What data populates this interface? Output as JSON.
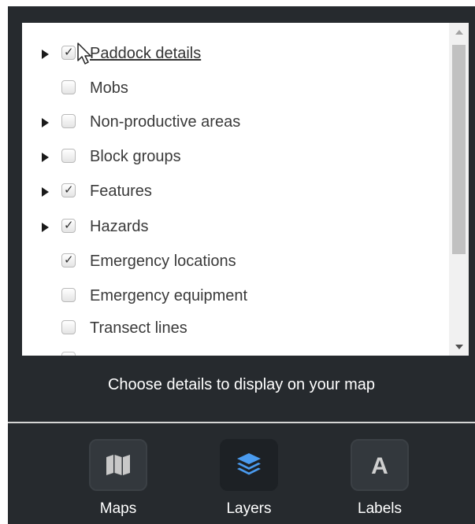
{
  "layers": {
    "items": [
      {
        "label": "Paddock details",
        "checked": true,
        "expandable": true,
        "link": true
      },
      {
        "label": "Mobs",
        "checked": false,
        "expandable": false,
        "link": false
      },
      {
        "label": "Non-productive areas",
        "checked": false,
        "expandable": true,
        "link": false
      },
      {
        "label": "Block groups",
        "checked": false,
        "expandable": true,
        "link": false
      },
      {
        "label": "Features",
        "checked": true,
        "expandable": true,
        "link": false
      },
      {
        "label": "Hazards",
        "checked": true,
        "expandable": true,
        "link": false
      },
      {
        "label": "Emergency locations",
        "checked": true,
        "expandable": false,
        "link": false
      },
      {
        "label": "Emergency equipment",
        "checked": false,
        "expandable": false,
        "link": false
      },
      {
        "label": "Transect lines",
        "checked": false,
        "expandable": false,
        "link": false
      }
    ]
  },
  "caption": "Choose details to display on your map",
  "toolbar": {
    "maps_label": "Maps",
    "layers_label": "Layers",
    "labels_label": "Labels",
    "labels_glyph": "A",
    "active": "layers",
    "accent_color": "#3a8ee6"
  },
  "icons": {
    "expand": "triangle-right-icon",
    "check": "checkmark-icon",
    "maps": "map-icon",
    "layers": "layers-icon",
    "labels": "letter-a-icon",
    "cursor": "mouse-pointer-icon"
  }
}
